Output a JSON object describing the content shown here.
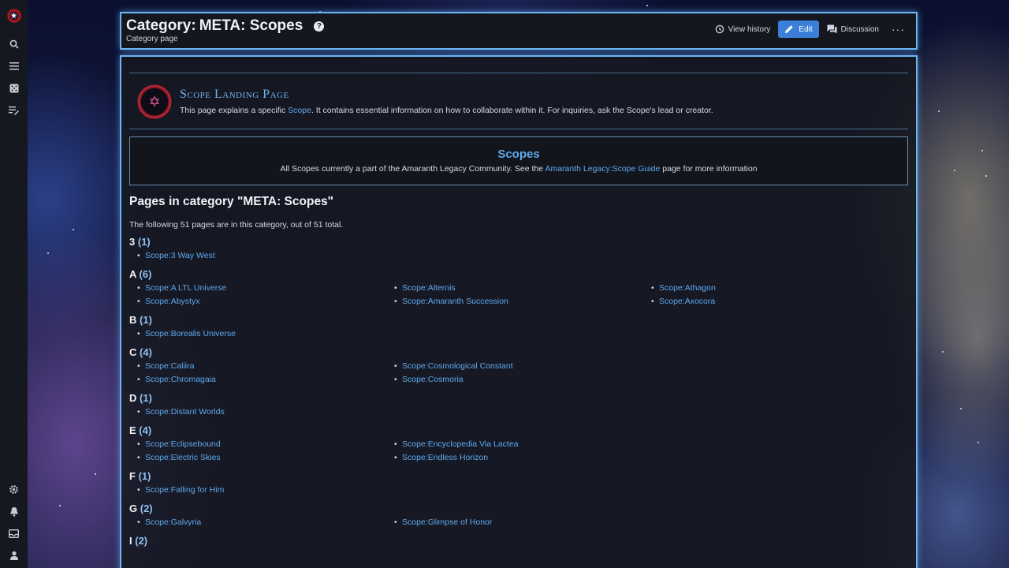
{
  "rail": {
    "logo": "amaranth-logo",
    "top_icons": [
      "search-icon",
      "menu-icon",
      "dice-icon",
      "list-edit-icon"
    ],
    "bottom_icons": [
      "gear-icon",
      "bell-icon",
      "inbox-icon",
      "user-icon"
    ]
  },
  "header": {
    "namespace": "Category:",
    "title": "META: Scopes",
    "subtitle": "Category page",
    "actions": {
      "history": "View history",
      "edit": "Edit",
      "discussion": "Discussion",
      "more": "···"
    }
  },
  "notice": {
    "title": "Scope Landing Page",
    "text_before": "This page explains a specific ",
    "link": "Scope",
    "text_after": ". It contains essential information on how to collaborate within it. For inquiries, ask the Scope's lead or creator."
  },
  "scopes_box": {
    "heading": "Scopes",
    "text_before": "All Scopes currently a part of the Amaranth Legacy Community. See the ",
    "link": "Amaranth Legacy:Scope Guide",
    "text_after": " page for more information"
  },
  "category": {
    "heading": "Pages in category \"META: Scopes\"",
    "intro": "The following 51 pages are in this category, out of 51 total.",
    "groups": [
      {
        "letter": "3",
        "count": "(1)",
        "pages": [
          "Scope:3 Way West"
        ]
      },
      {
        "letter": "A",
        "count": "(6)",
        "pages": [
          "Scope:A LTL Universe",
          "Scope:Alternis",
          "Scope:Athagon",
          "Scope:Abystyx",
          "Scope:Amaranth Succession",
          "Scope:Axocora"
        ]
      },
      {
        "letter": "B",
        "count": "(1)",
        "pages": [
          "Scope:Borealis Universe"
        ]
      },
      {
        "letter": "C",
        "count": "(4)",
        "pages": [
          "Scope:Caliira",
          "Scope:Cosmological Constant",
          "",
          "Scope:Chromagaia",
          "Scope:Cosmoria"
        ]
      },
      {
        "letter": "D",
        "count": "(1)",
        "pages": [
          "Scope:Distant Worlds"
        ]
      },
      {
        "letter": "E",
        "count": "(4)",
        "pages": [
          "Scope:Eclipsebound",
          "Scope:Encyclopedia Via Lactea",
          "",
          "Scope:Electric Skies",
          "Scope:Endless Horizon"
        ]
      },
      {
        "letter": "F",
        "count": "(1)",
        "pages": [
          "Scope:Falling for Him"
        ]
      },
      {
        "letter": "G",
        "count": "(2)",
        "pages": [
          "Scope:Galvyria",
          "Scope:Glimpse of Honor"
        ]
      },
      {
        "letter": "I",
        "count": "(2)",
        "pages": []
      }
    ]
  }
}
